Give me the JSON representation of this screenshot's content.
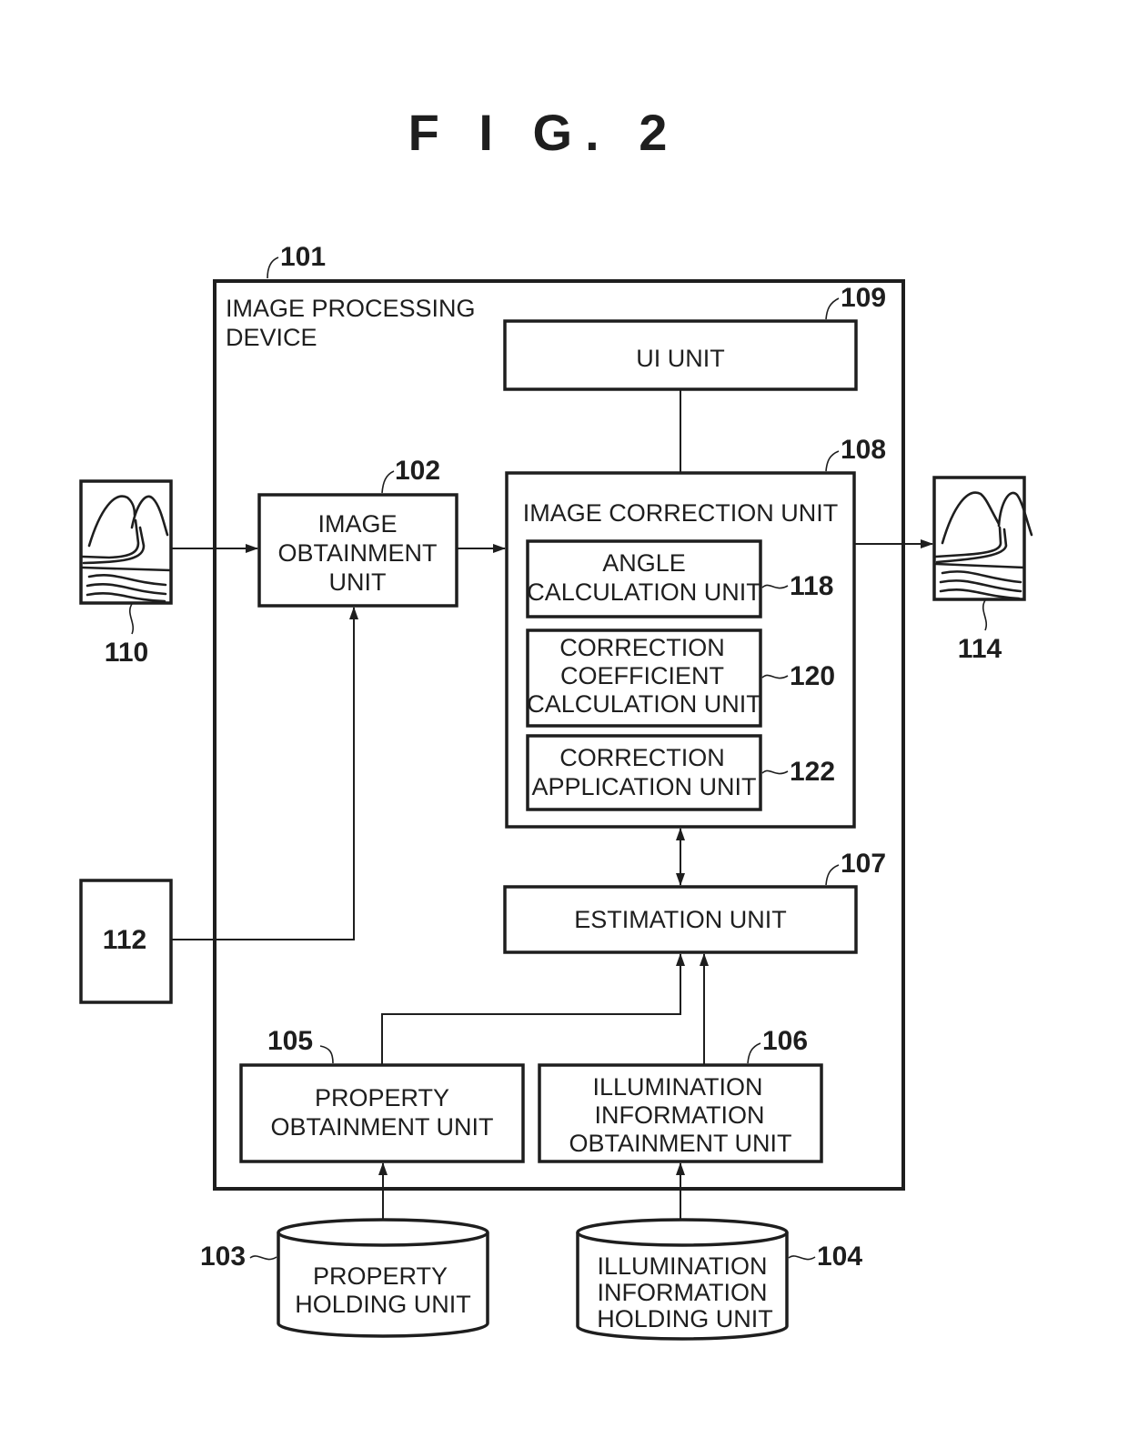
{
  "figure": {
    "title": "F I G.  2"
  },
  "device": {
    "ref": "101",
    "label_lines": [
      "IMAGE PROCESSING",
      "DEVICE"
    ]
  },
  "units": {
    "ui": {
      "ref": "109",
      "lines": [
        "UI UNIT"
      ]
    },
    "image_obtainment": {
      "ref": "102",
      "lines": [
        "IMAGE",
        "OBTAINMENT",
        "UNIT"
      ]
    },
    "image_correction": {
      "ref": "108",
      "lines": [
        "IMAGE CORRECTION UNIT"
      ]
    },
    "angle_calculation": {
      "ref": "118",
      "lines": [
        "ANGLE",
        "CALCULATION UNIT"
      ]
    },
    "correction_coefficient": {
      "ref": "120",
      "lines": [
        "CORRECTION",
        "COEFFICIENT",
        "CALCULATION UNIT"
      ]
    },
    "correction_application": {
      "ref": "122",
      "lines": [
        "CORRECTION",
        "APPLICATION UNIT"
      ]
    },
    "estimation": {
      "ref": "107",
      "lines": [
        "ESTIMATION UNIT"
      ]
    },
    "property_obtainment": {
      "ref": "105",
      "lines": [
        "PROPERTY",
        "OBTAINMENT UNIT"
      ]
    },
    "illumination_obtainment": {
      "ref": "106",
      "lines": [
        "ILLUMINATION",
        "INFORMATION",
        "OBTAINMENT UNIT"
      ]
    },
    "property_holding": {
      "ref": "103",
      "lines": [
        "PROPERTY",
        "HOLDING UNIT"
      ]
    },
    "illumination_holding": {
      "ref": "104",
      "lines": [
        "ILLUMINATION",
        "INFORMATION",
        "HOLDING UNIT"
      ]
    }
  },
  "external": {
    "input_image": {
      "ref": "110",
      "icon": "landscape-image-icon"
    },
    "output_image": {
      "ref": "114",
      "icon": "landscape-image-icon"
    },
    "input_device": {
      "ref": "112"
    }
  }
}
